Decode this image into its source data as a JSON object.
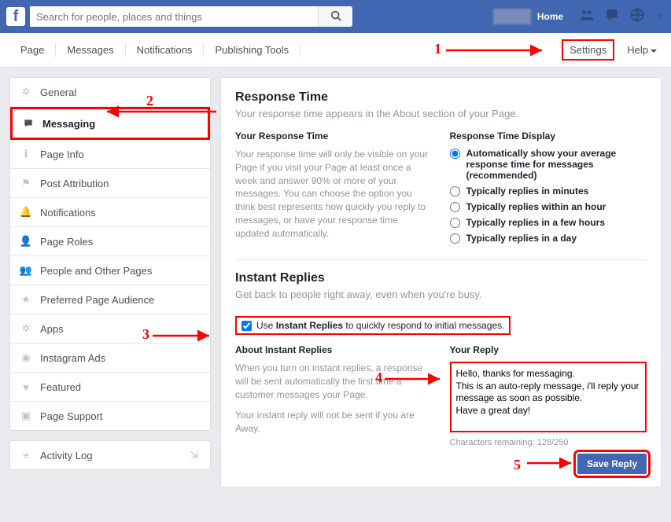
{
  "topbar": {
    "search_placeholder": "Search for people, places and things",
    "home": "Home"
  },
  "pagenav": {
    "items": [
      "Page",
      "Messages",
      "Notifications",
      "Publishing Tools"
    ],
    "settings": "Settings",
    "help": "Help"
  },
  "sidebar": {
    "items": [
      {
        "label": "General",
        "icon": "gear-icon"
      },
      {
        "label": "Messaging",
        "icon": "chat-icon"
      },
      {
        "label": "Page Info",
        "icon": "info-icon"
      },
      {
        "label": "Post Attribution",
        "icon": "flag-icon"
      },
      {
        "label": "Notifications",
        "icon": "bell-icon"
      },
      {
        "label": "Page Roles",
        "icon": "person-icon"
      },
      {
        "label": "People and Other Pages",
        "icon": "people-icon"
      },
      {
        "label": "Preferred Page Audience",
        "icon": "star-icon"
      },
      {
        "label": "Apps",
        "icon": "apps-icon"
      },
      {
        "label": "Instagram Ads",
        "icon": "instagram-icon"
      },
      {
        "label": "Featured",
        "icon": "heart-icon"
      },
      {
        "label": "Page Support",
        "icon": "support-icon"
      }
    ],
    "activity_log": "Activity Log"
  },
  "response_time": {
    "title": "Response Time",
    "sub": "Your response time appears in the About section of your Page.",
    "col1_title": "Your Response Time",
    "col1_body": "Your response time will only be visible on your Page if you visit your Page at least once a week and answer 90% or more of your messages. You can choose the option you think best represents how quickly you reply to messages, or have your response time updated automatically.",
    "col2_title": "Response Time Display",
    "radios": [
      "Automatically show your average response time for messages (recommended)",
      "Typically replies in minutes",
      "Typically replies within an hour",
      "Typically replies in a few hours",
      "Typically replies in a day"
    ]
  },
  "instant_replies": {
    "title": "Instant Replies",
    "sub": "Get back to people right away, even when you're busy.",
    "checkbox_prefix": "Use ",
    "checkbox_bold": "Instant Replies",
    "checkbox_suffix": " to quickly respond to initial messages.",
    "col1_title": "About Instant Replies",
    "col1_body": "When you turn on instant replies, a response will be sent automatically the first time a customer messages your Page.",
    "col1_note": "Your instant reply will not be sent if you are Away.",
    "col2_title": "Your Reply",
    "reply_value": "Hello, thanks for messaging.\nThis is an auto-reply message, i'll reply your message as soon as possible.\nHave a great day!",
    "char_count": "Characters remaining: 128/250",
    "save_label": "Save Reply"
  },
  "annotations": {
    "n1": "1",
    "n2": "2",
    "n3": "3",
    "n4": "4",
    "n5": "5"
  }
}
